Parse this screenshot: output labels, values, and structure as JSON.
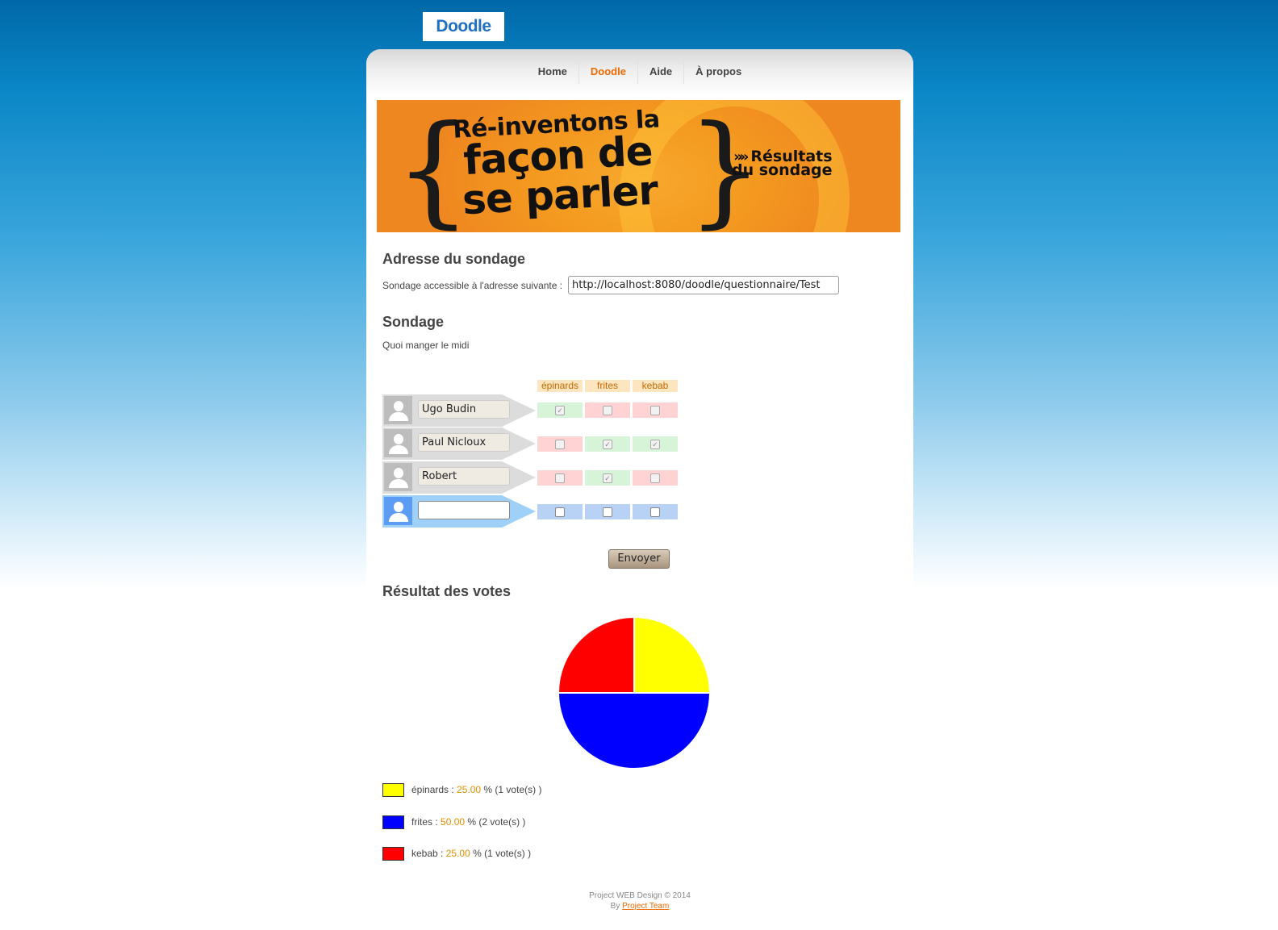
{
  "logo": {
    "text": "Doodle"
  },
  "nav": {
    "items": [
      {
        "label": "Home",
        "active": false
      },
      {
        "label": "Doodle",
        "active": true
      },
      {
        "label": "Aide",
        "active": false
      },
      {
        "label": "À propos",
        "active": false
      }
    ]
  },
  "banner": {
    "line1": "Ré-inventons la",
    "line2": "façon de",
    "line3": "se parler",
    "results_line1": "Résultats",
    "results_line2": "du sondage"
  },
  "address": {
    "title": "Adresse du sondage",
    "label": "Sondage accessible à l'adresse suivante :",
    "url": "http://localhost:8080/doodle/questionnaire/Test"
  },
  "poll": {
    "title": "Sondage",
    "description": "Quoi manger le midi",
    "options": [
      "épinards",
      "frites",
      "kebab"
    ],
    "participants": [
      {
        "name": "Ugo Budin",
        "votes": [
          true,
          false,
          false
        ]
      },
      {
        "name": "Paul Nicloux",
        "votes": [
          false,
          true,
          true
        ]
      },
      {
        "name": "Robert",
        "votes": [
          false,
          true,
          false
        ]
      }
    ],
    "new_name": "",
    "submit_label": "Envoyer"
  },
  "results": {
    "title": "Résultat des votes",
    "legend": [
      {
        "name": "épinards",
        "pct": "25.00",
        "votes_text": "% (1 vote(s) )",
        "color": "#ffff00"
      },
      {
        "name": "frites",
        "pct": "50.00",
        "votes_text": "% (2 vote(s) )",
        "color": "#0000ff"
      },
      {
        "name": "kebab",
        "pct": "25.00",
        "votes_text": "% (1 vote(s) )",
        "color": "#ff0000"
      }
    ]
  },
  "chart_data": {
    "type": "pie",
    "categories": [
      "épinards",
      "frites",
      "kebab"
    ],
    "values": [
      25,
      50,
      25
    ],
    "colors": [
      "#ffff00",
      "#0000ff",
      "#ff0000"
    ]
  },
  "footer": {
    "line1": "Project WEB Design © 2014",
    "by": "By",
    "link": "Project Team"
  }
}
